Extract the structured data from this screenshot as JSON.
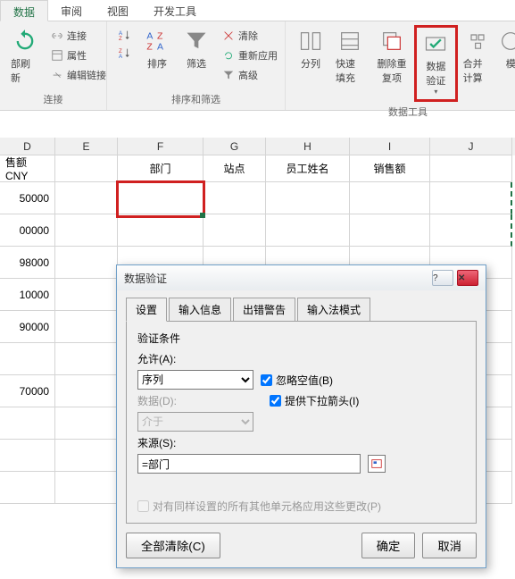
{
  "tabs": [
    "数据",
    "审阅",
    "视图",
    "开发工具"
  ],
  "active_tab": 0,
  "ribbon": {
    "group1": {
      "refresh": "部刷新",
      "items": [
        "连接",
        "属性",
        "编辑链接"
      ],
      "label": "连接"
    },
    "group2": {
      "az": "A↓Z",
      "sort": "排序",
      "filter": "筛选",
      "items": [
        "清除",
        "重新应用",
        "高级"
      ],
      "label": "排序和筛选"
    },
    "group3": {
      "split": "分列",
      "flash": "快速填充",
      "dedup": "删除重复项",
      "dv": "数据验证",
      "consol": "合并计算",
      "sim": "模",
      "label": "数据工具"
    }
  },
  "columns": [
    "D",
    "E",
    "F",
    "G",
    "H",
    "I",
    "J"
  ],
  "headers": {
    "d": "售额CNY",
    "f": "部门",
    "g": "站点",
    "h": "员工姓名",
    "i": "销售额"
  },
  "col_d": [
    "50000",
    "00000",
    "98000",
    "10000",
    "90000",
    "",
    "70000",
    "",
    "",
    ""
  ],
  "dialog": {
    "title": "数据验证",
    "tabs": [
      "设置",
      "输入信息",
      "出错警告",
      "输入法模式"
    ],
    "active": 0,
    "section": "验证条件",
    "allow_label": "允许(A):",
    "allow_value": "序列",
    "data_label": "数据(D):",
    "data_value": "介于",
    "ignore_blank": "忽略空值(B)",
    "dropdown": "提供下拉箭头(I)",
    "source_label": "来源(S):",
    "source_value": "=部门",
    "apply_all": "对有同样设置的所有其他单元格应用这些更改(P)",
    "clear": "全部清除(C)",
    "ok": "确定",
    "cancel": "取消"
  }
}
